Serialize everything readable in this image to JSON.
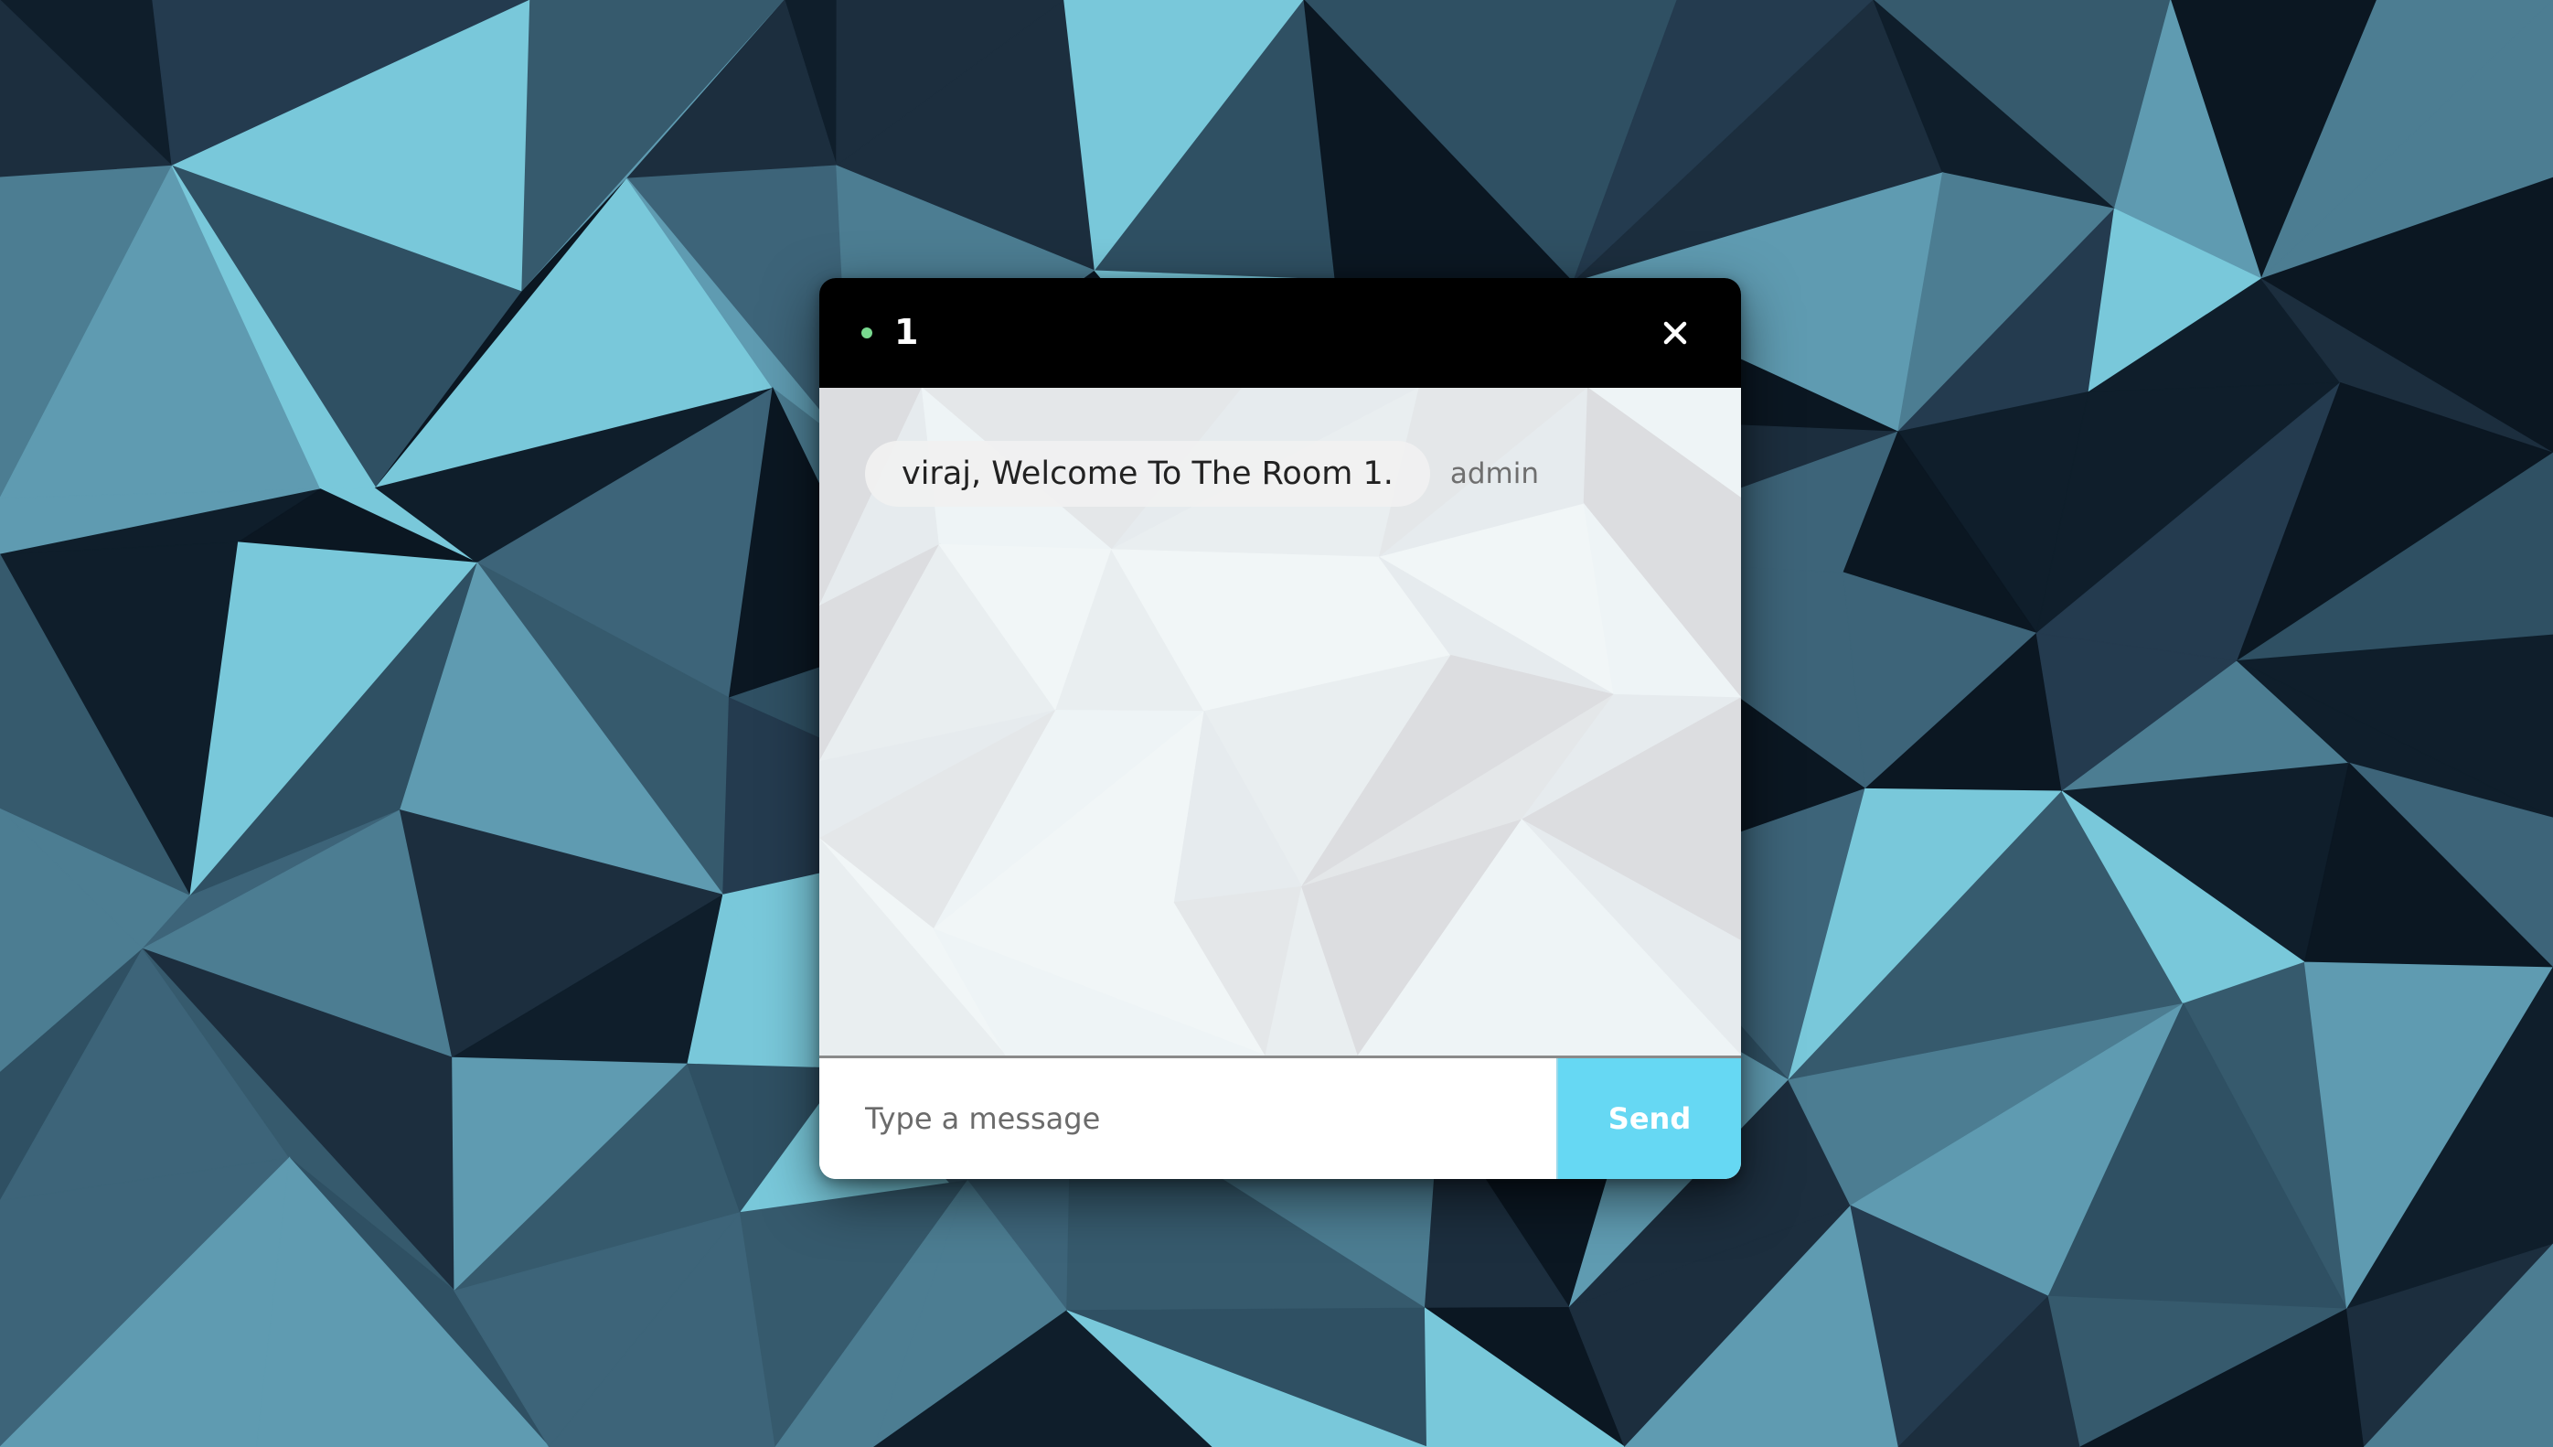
{
  "chat": {
    "room_name": "1",
    "status_color": "#79d98f",
    "close_icon": "close-icon",
    "messages": [
      {
        "text": "viraj, Welcome To The Room 1.",
        "sender": "admin"
      }
    ],
    "input_placeholder": "Type a message",
    "input_value": "",
    "send_label": "Send"
  },
  "colors": {
    "header": "#000000",
    "send_button": "#66d8f3",
    "background_accent": "#7ac8da"
  }
}
